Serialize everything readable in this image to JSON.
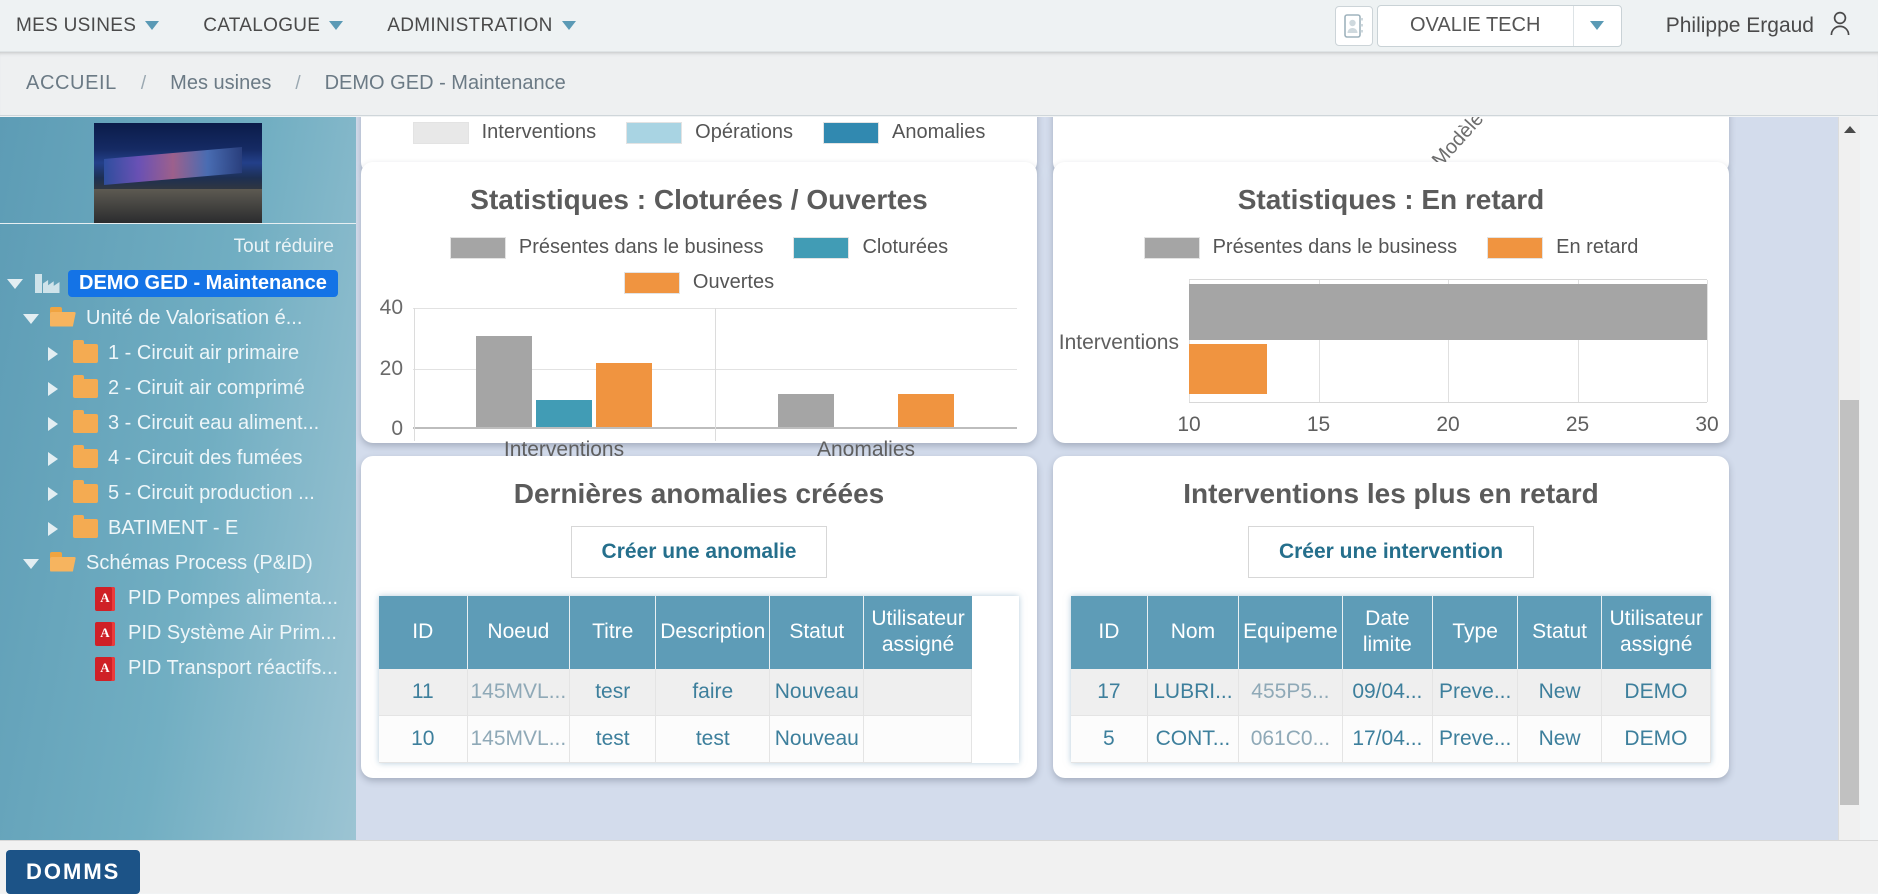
{
  "topnav": {
    "items": [
      {
        "label": "MES USINES"
      },
      {
        "label": "CATALOGUE"
      },
      {
        "label": "ADMINISTRATION"
      }
    ],
    "org_name": "OVALIE TECH",
    "user_name": "Philippe Ergaud"
  },
  "breadcrumb": {
    "home": "ACCUEIL",
    "sep": "/",
    "level1": "Mes usines",
    "level2": "DEMO GED - Maintenance"
  },
  "sidebar": {
    "collapse_all": "Tout réduire",
    "tree": [
      {
        "label": "DEMO GED - Maintenance",
        "icon": "factory-icon",
        "expander": "down",
        "indent": 0,
        "selected": true
      },
      {
        "label": "Unité de Valorisation é...",
        "icon": "folder-open-icon",
        "expander": "down",
        "indent": 1,
        "selected": false
      },
      {
        "label": "1 - Circuit air primaire",
        "icon": "folder-closed-icon",
        "expander": "right",
        "indent": 2,
        "selected": false
      },
      {
        "label": "2 - Ciruit air comprimé",
        "icon": "folder-closed-icon",
        "expander": "right",
        "indent": 2,
        "selected": false
      },
      {
        "label": "3 - Circuit eau aliment...",
        "icon": "folder-closed-icon",
        "expander": "right",
        "indent": 2,
        "selected": false
      },
      {
        "label": "4 - Circuit des fumées",
        "icon": "folder-closed-icon",
        "expander": "right",
        "indent": 2,
        "selected": false
      },
      {
        "label": "5 - Circuit production ...",
        "icon": "folder-closed-icon",
        "expander": "right",
        "indent": 2,
        "selected": false
      },
      {
        "label": "BATIMENT - E",
        "icon": "folder-closed-icon",
        "expander": "right",
        "indent": 2,
        "selected": false
      },
      {
        "label": "Schémas Process (P&ID)",
        "icon": "folder-open-icon",
        "expander": "down",
        "indent": 1,
        "selected": false
      },
      {
        "label": "PID Pompes alimenta...",
        "icon": "pdf-icon",
        "expander": "none",
        "indent": 3,
        "selected": false
      },
      {
        "label": "PID Système Air Prim...",
        "icon": "pdf-icon",
        "expander": "none",
        "indent": 3,
        "selected": false
      },
      {
        "label": "PID Transport réactifs...",
        "icon": "pdf-icon",
        "expander": "none",
        "indent": 3,
        "selected": false
      }
    ]
  },
  "top_cards": {
    "left_legend": [
      {
        "label": "Interventions",
        "color": "#e8e8e8"
      },
      {
        "label": "Opérations",
        "color": "#a9d4e3"
      },
      {
        "label": "Anomalies",
        "color": "#3189b0"
      }
    ],
    "right_partial_label": "Modèle-"
  },
  "chart_data": [
    {
      "type": "bar",
      "title": "Statistiques : Cloturées / Ouvertes",
      "orientation": "vertical",
      "categories": [
        "Interventions",
        "Anomalies"
      ],
      "series": [
        {
          "name": "Présentes dans le business",
          "color": "#a5a5a5",
          "values": [
            30,
            11
          ]
        },
        {
          "name": "Cloturées",
          "color": "#419cb5",
          "values": [
            9,
            null
          ]
        },
        {
          "name": "Ouvertes",
          "color": "#f09440",
          "values": [
            21,
            11
          ]
        }
      ],
      "yticks": [
        0,
        20,
        40
      ],
      "ylim": [
        0,
        40
      ],
      "xlabel": "",
      "ylabel": "",
      "grid": true,
      "legend_position": "top"
    },
    {
      "type": "bar",
      "title": "Statistiques : En retard",
      "orientation": "horizontal",
      "categories": [
        "Interventions"
      ],
      "series": [
        {
          "name": "Présentes dans le business",
          "color": "#a5a5a5",
          "values": [
            30
          ]
        },
        {
          "name": "En retard",
          "color": "#f09440",
          "values": [
            13
          ]
        }
      ],
      "xticks": [
        10,
        15,
        20,
        25,
        30
      ],
      "xlim": [
        10,
        30
      ],
      "xlabel": "",
      "ylabel": "",
      "grid": true,
      "legend_position": "top"
    }
  ],
  "anomalies_card": {
    "title": "Dernières anomalies créées",
    "button": "Créer une anomalie",
    "columns": [
      "ID",
      "Noeud",
      "Titre",
      "Description",
      "Statut",
      "Utilisateur assigné"
    ],
    "rows": [
      {
        "id": "11",
        "noeud": "145MVL...",
        "titre": "tesr",
        "description": "faire",
        "statut": "Nouveau",
        "utilisateur": ""
      },
      {
        "id": "10",
        "noeud": "145MVL...",
        "titre": "test",
        "description": "test",
        "statut": "Nouveau",
        "utilisateur": ""
      }
    ]
  },
  "interventions_card": {
    "title": "Interventions les plus en retard",
    "button": "Créer une intervention",
    "columns": [
      "ID",
      "Nom",
      "Equipeme",
      "Date limite",
      "Type",
      "Statut",
      "Utilisateur assigné"
    ],
    "rows": [
      {
        "id": "17",
        "nom": "LUBRI...",
        "equipement": "455P5...",
        "date": "09/04...",
        "type": "Preve...",
        "statut": "New",
        "utilisateur": "DEMO"
      },
      {
        "id": "5",
        "nom": "CONT...",
        "equipement": "061C0...",
        "date": "17/04...",
        "type": "Preve...",
        "statut": "New",
        "utilisateur": "DEMO"
      }
    ]
  },
  "footer": {
    "logo": "DOMMS"
  },
  "colors": {
    "accent_blue": "#5e9cb7",
    "orange": "#f09440",
    "teal": "#419cb5",
    "gray": "#a5a5a5",
    "selected_blue": "#1473e6",
    "content_bg": "#d3dcec"
  }
}
